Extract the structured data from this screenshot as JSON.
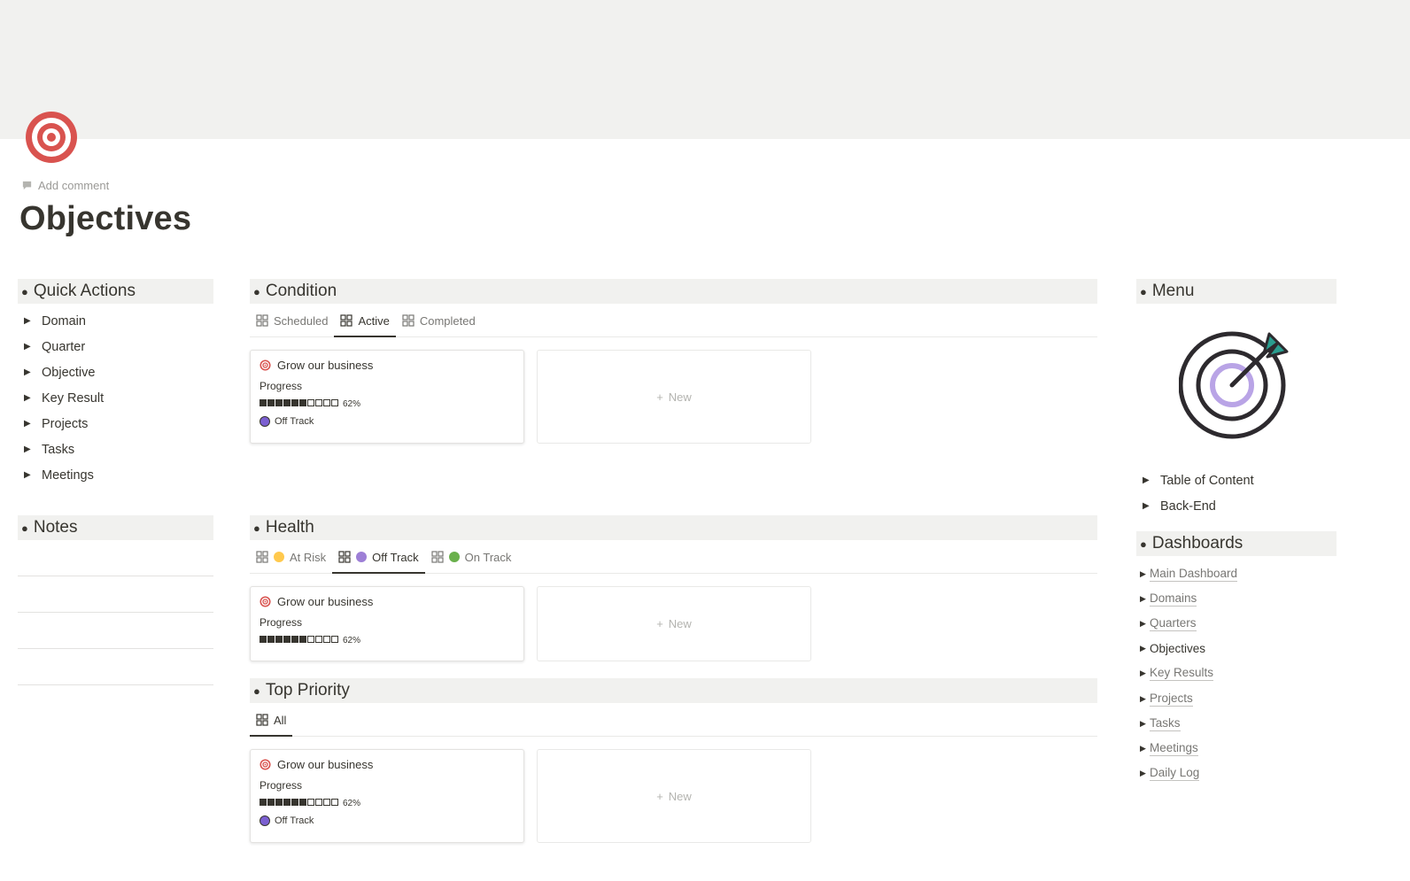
{
  "page": {
    "add_comment": "Add comment",
    "title": "Objectives"
  },
  "quick_actions": {
    "header": "Quick Actions",
    "items": [
      "Domain",
      "Quarter",
      "Objective",
      "Key Result",
      "Projects",
      "Tasks",
      "Meetings"
    ]
  },
  "notes": {
    "header": "Notes"
  },
  "condition": {
    "header": "Condition",
    "tabs": [
      "Scheduled",
      "Active",
      "Completed"
    ],
    "active_tab": "Active",
    "card": {
      "title": "Grow our business",
      "progress_label": "Progress",
      "progress_text": "62%",
      "progress_value": 0.62,
      "status": "Off Track"
    },
    "new_label": "New"
  },
  "health": {
    "header": "Health",
    "tabs": [
      {
        "label": "At Risk",
        "color": "#ffc94d"
      },
      {
        "label": "Off Track",
        "color": "#9d7fd6"
      },
      {
        "label": "On Track",
        "color": "#6ab04c"
      }
    ],
    "active_tab": "Off Track",
    "card": {
      "title": "Grow our business",
      "progress_label": "Progress",
      "progress_text": "62%",
      "progress_value": 0.62
    },
    "new_label": "New"
  },
  "top_priority": {
    "header": "Top Priority",
    "tabs": [
      "All"
    ],
    "active_tab": "All",
    "card": {
      "title": "Grow our business",
      "progress_label": "Progress",
      "progress_text": "62%",
      "progress_value": 0.62,
      "status": "Off Track"
    },
    "new_label": "New"
  },
  "menu": {
    "header": "Menu",
    "toggles": [
      "Table of Content",
      "Back-End"
    ]
  },
  "dashboards": {
    "header": "Dashboards",
    "items": [
      {
        "label": "Main Dashboard",
        "link": true
      },
      {
        "label": "Domains",
        "link": true
      },
      {
        "label": "Quarters",
        "link": true
      },
      {
        "label": "Objectives",
        "link": false
      },
      {
        "label": "Key Results",
        "link": true
      },
      {
        "label": "Projects",
        "link": true
      },
      {
        "label": "Tasks",
        "link": true
      },
      {
        "label": "Meetings",
        "link": true
      },
      {
        "label": "Daily Log",
        "link": true
      }
    ]
  },
  "colors": {
    "target_red": "#d9534f",
    "status_off_track": "#7b5fd1",
    "cover_bg": "#f1f1ef"
  }
}
